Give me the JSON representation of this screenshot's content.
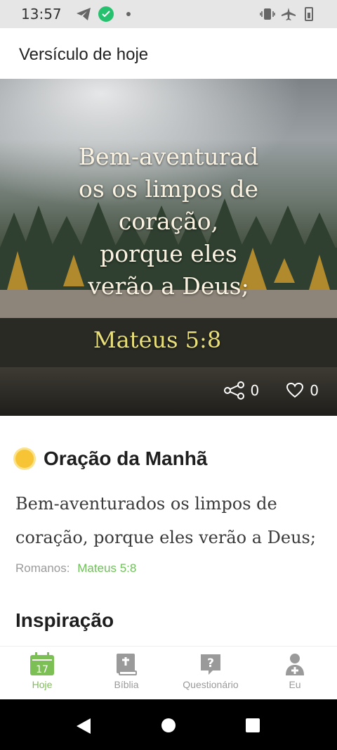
{
  "status": {
    "time": "13:57"
  },
  "header": {
    "title": "Versículo de hoje"
  },
  "hero": {
    "verse_lines": [
      "Bem-aventurad",
      "os os limpos de",
      "coração,",
      "porque eles",
      "verão a Deus;"
    ],
    "reference": "Mateus 5:8",
    "share_count": "0",
    "like_count": "0"
  },
  "prayer": {
    "title": "Oração da Manhã",
    "text": "Bem-aventurados os limpos de coração, porque eles verão a Deus;",
    "source_label": "Romanos:",
    "source_ref": "Mateus 5:8"
  },
  "inspiration": {
    "title": "Inspiração"
  },
  "nav": {
    "items": [
      {
        "label": "Hoje",
        "icon": "calendar-icon",
        "day": "17",
        "active": true
      },
      {
        "label": "Bíblia",
        "icon": "bible-icon"
      },
      {
        "label": "Questionário",
        "icon": "question-icon"
      },
      {
        "label": "Eu",
        "icon": "profile-icon"
      }
    ]
  },
  "colors": {
    "accent": "#7cbf55",
    "ref_gold": "#e8df7a",
    "sun": "#f6c435"
  }
}
